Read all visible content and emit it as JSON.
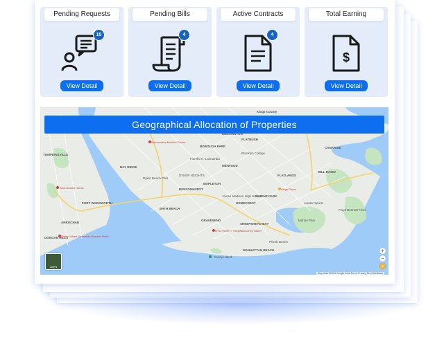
{
  "cards": [
    {
      "title": "Pending Requests",
      "icon": "chat-person-icon",
      "badge": "15",
      "button": "View Detail"
    },
    {
      "title": "Pending Bills",
      "icon": "bill-icon",
      "badge": "4",
      "button": "View Detail"
    },
    {
      "title": "Active Contracts",
      "icon": "document-icon",
      "badge": "4",
      "button": "View Detail"
    },
    {
      "title": "Total Earning",
      "icon": "dollar-document-icon",
      "badge": "",
      "button": "View Detail"
    }
  ],
  "map": {
    "title": "Geographical Allocation of Properties",
    "layers_label": "Layers",
    "attribution": "Map data ©2023 Google   India   Terms   Privacy   Send feedback",
    "zoom_in": "+",
    "zoom_out": "−",
    "places": {
      "kings_county": "Kings County",
      "marlboro": "Maimonides Medical Center",
      "dyker": "DYKER HEIGHTS",
      "bensonhurst": "BENSONHURST",
      "bath_beach": "BATH BEACH",
      "gravesend": "GRAVESEND",
      "homecrest": "HOMECREST",
      "flatlands": "FLATLANDS",
      "marine_park": "MARINE PARK",
      "sheepshead": "SHEEPSHEAD BAY",
      "manhattan_beach": "MANHATTAN BEACH",
      "midwood": "MIDWOOD",
      "brooklyn_college": "Brooklyn College",
      "james_madison": "James Madison High School",
      "kings_plaza": "Kings Plaza",
      "coney_island": "Coney Island",
      "nyc_health": "NYC Health + Hospitals/Coney Island",
      "mill_basin": "MILL BASIN",
      "canarsie": "CANARSIE",
      "tompkinsville": "TOMPKINSVILLE",
      "arrochar": "ARROCHAR",
      "dongan_hills": "DONGAN HILLS",
      "alice_austen": "Alice Austen House",
      "staten_island_hospital": "Staten Island University Hospital North",
      "fort_wadsworth": "FORT WADSWORTH",
      "bay_ridge": "BAY RIDGE",
      "mapleton": "MAPLETON",
      "borough_park": "BOROUGH PARK",
      "flatbush": "FLATBUSH",
      "kensington": "KENSINGTON",
      "fiorello": "Fiorello H. LaGuardia",
      "shore_park": "Dyker Beach Park",
      "plumb_beach": "Plumb Beach",
      "aviator": "Aviator Sports",
      "marine_park_green": "Marine Park",
      "floyd_bennett": "Floyd Bennett Field"
    }
  },
  "colors": {
    "accent": "#0d6ef0",
    "card_bg": "#e3ecf8",
    "water": "#9ecbf7",
    "land": "#e9ece7",
    "park": "#c5e4c0"
  }
}
